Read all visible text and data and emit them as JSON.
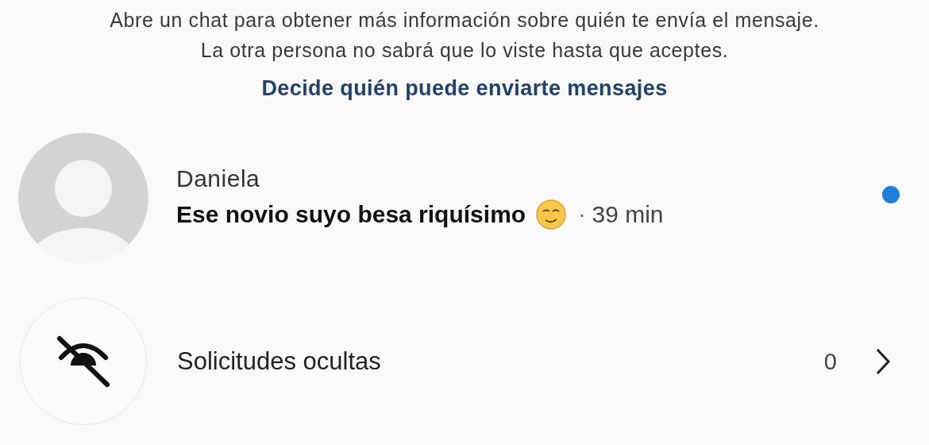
{
  "intro": {
    "lines": [
      "Abre un chat para obtener más información sobre quién te envía el mensaje.",
      "La otra persona no sabrá que lo viste hasta que aceptes."
    ],
    "link": "Decide quién puede enviarte mensajes"
  },
  "requests": [
    {
      "name": "Daniela",
      "message": "Ese novio suyo besa riquísimo",
      "separator": "·",
      "time": "39 min",
      "unread": true
    }
  ],
  "hidden": {
    "label": "Solicitudes ocultas",
    "count": "0"
  }
}
